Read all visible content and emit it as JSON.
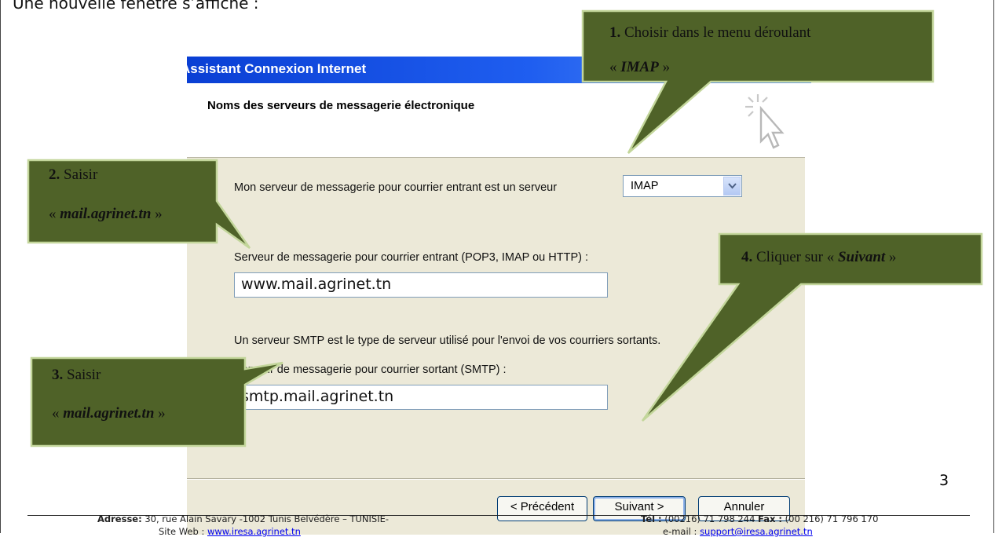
{
  "intro_text": "Une nouvelle fenêtre s’affiche :",
  "wizard": {
    "title": "Assistant Connexion Internet",
    "subtitle": "Noms des serveurs de messagerie électronique",
    "incoming_type_label": "Mon serveur de messagerie pour courrier entrant est un serveur",
    "incoming_type_value": "IMAP",
    "incoming_label": "Serveur de messagerie pour courrier entrant (POP3, IMAP ou HTTP) :",
    "incoming_value": "www.mail.agrinet.tn",
    "smtp_info": "Un serveur SMTP est le type de serveur utilisé pour l'envoi de vos courriers sortants.",
    "outgoing_label": "Serveur de messagerie pour courrier sortant (SMTP) :",
    "outgoing_value": "smtp.mail.agrinet.tn",
    "buttons": {
      "previous": "< Précédent",
      "next": "Suivant >",
      "cancel": "Annuler"
    }
  },
  "callouts": {
    "c1": {
      "num": "1.",
      "text": "Choisir dans le menu déroulant",
      "quote_open": "«",
      "value": "IMAP",
      "quote_close": "»"
    },
    "c2": {
      "num": "2.",
      "text": "Saisir",
      "quote_open": "«",
      "value": "mail.agrinet.tn",
      "quote_close": "»"
    },
    "c3": {
      "num": "3.",
      "text": "Saisir",
      "quote_open": "«",
      "value": "mail.agrinet.tn",
      "quote_close": "»"
    },
    "c4": {
      "num": "4.",
      "text": "Cliquer sur «",
      "value": "Suivant",
      "quote_close": "»"
    }
  },
  "page_number": "3",
  "footer": {
    "address_label": "Adresse:",
    "address": "30, rue Alain Savary -1002 Tunis Belvédère – TUNISIE-",
    "tel_label": "Tél :",
    "tel": "(00216) 71 798 244",
    "fax_label": "Fax :",
    "fax": "(00 216) 71 796 170",
    "web_label": "Site Web :",
    "web": "www.iresa.agrinet.tn",
    "email_label": "e-mail :",
    "email": "support@iresa.agrinet.tn"
  },
  "colors": {
    "callout_fill": "#4f6228",
    "callout_border": "#c3d69b",
    "titlebar": "#0a3fd4",
    "dialog_bg": "#ece9d8"
  },
  "icons": [
    "cursor-click-icon",
    "dropdown-arrow-icon"
  ]
}
